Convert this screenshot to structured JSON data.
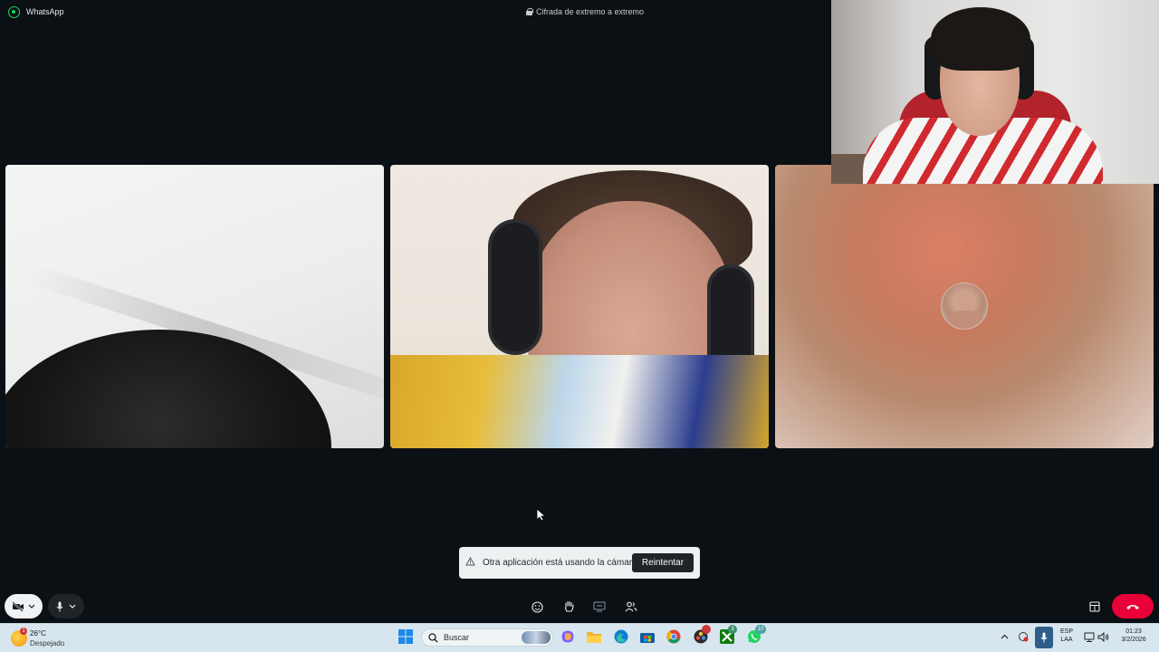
{
  "window": {
    "app_name": "WhatsApp",
    "encryption_label": "Cifrada de extremo a extremo"
  },
  "call": {
    "tiles": [
      {
        "id": "participant-1",
        "kind": "video"
      },
      {
        "id": "participant-2",
        "kind": "video"
      },
      {
        "id": "participant-3",
        "kind": "avatar"
      }
    ],
    "self_view": {
      "kind": "video"
    }
  },
  "toast": {
    "message": "Otra aplicación está usando la cámara.",
    "action_label": "Reintentar",
    "icon": "warning-icon"
  },
  "controls": {
    "camera": {
      "icon": "camera-off-icon",
      "state": "off"
    },
    "mic": {
      "icon": "microphone-icon",
      "state": "on"
    },
    "center": [
      {
        "icon": "emoji-icon"
      },
      {
        "icon": "raise-hand-icon"
      },
      {
        "icon": "share-screen-icon"
      },
      {
        "icon": "participants-icon"
      }
    ],
    "layout_icon": "layout-grid-icon",
    "end_call_icon": "end-call-icon"
  },
  "taskbar": {
    "weather": {
      "temp": "26°C",
      "desc": "Despejado",
      "badge": "1"
    },
    "search_placeholder": "Buscar",
    "apps": [
      "windows-start-icon",
      "search-icon",
      "copilot-icon",
      "file-explorer-icon",
      "edge-icon",
      "store-icon",
      "chrome-icon",
      "davinci-icon",
      "xbox-icon",
      "whatsapp-icon"
    ],
    "badges": {
      "xbox": "3",
      "whatsapp": "10"
    },
    "tray": {
      "lang_top": "ESP",
      "lang_bottom": "LAA",
      "time": "01:23",
      "date": "3/2/2026"
    }
  },
  "colors": {
    "background": "#0b1014",
    "accent": "#25d366",
    "end_call": "#ea0038",
    "taskbar": "#d7e6ee"
  }
}
